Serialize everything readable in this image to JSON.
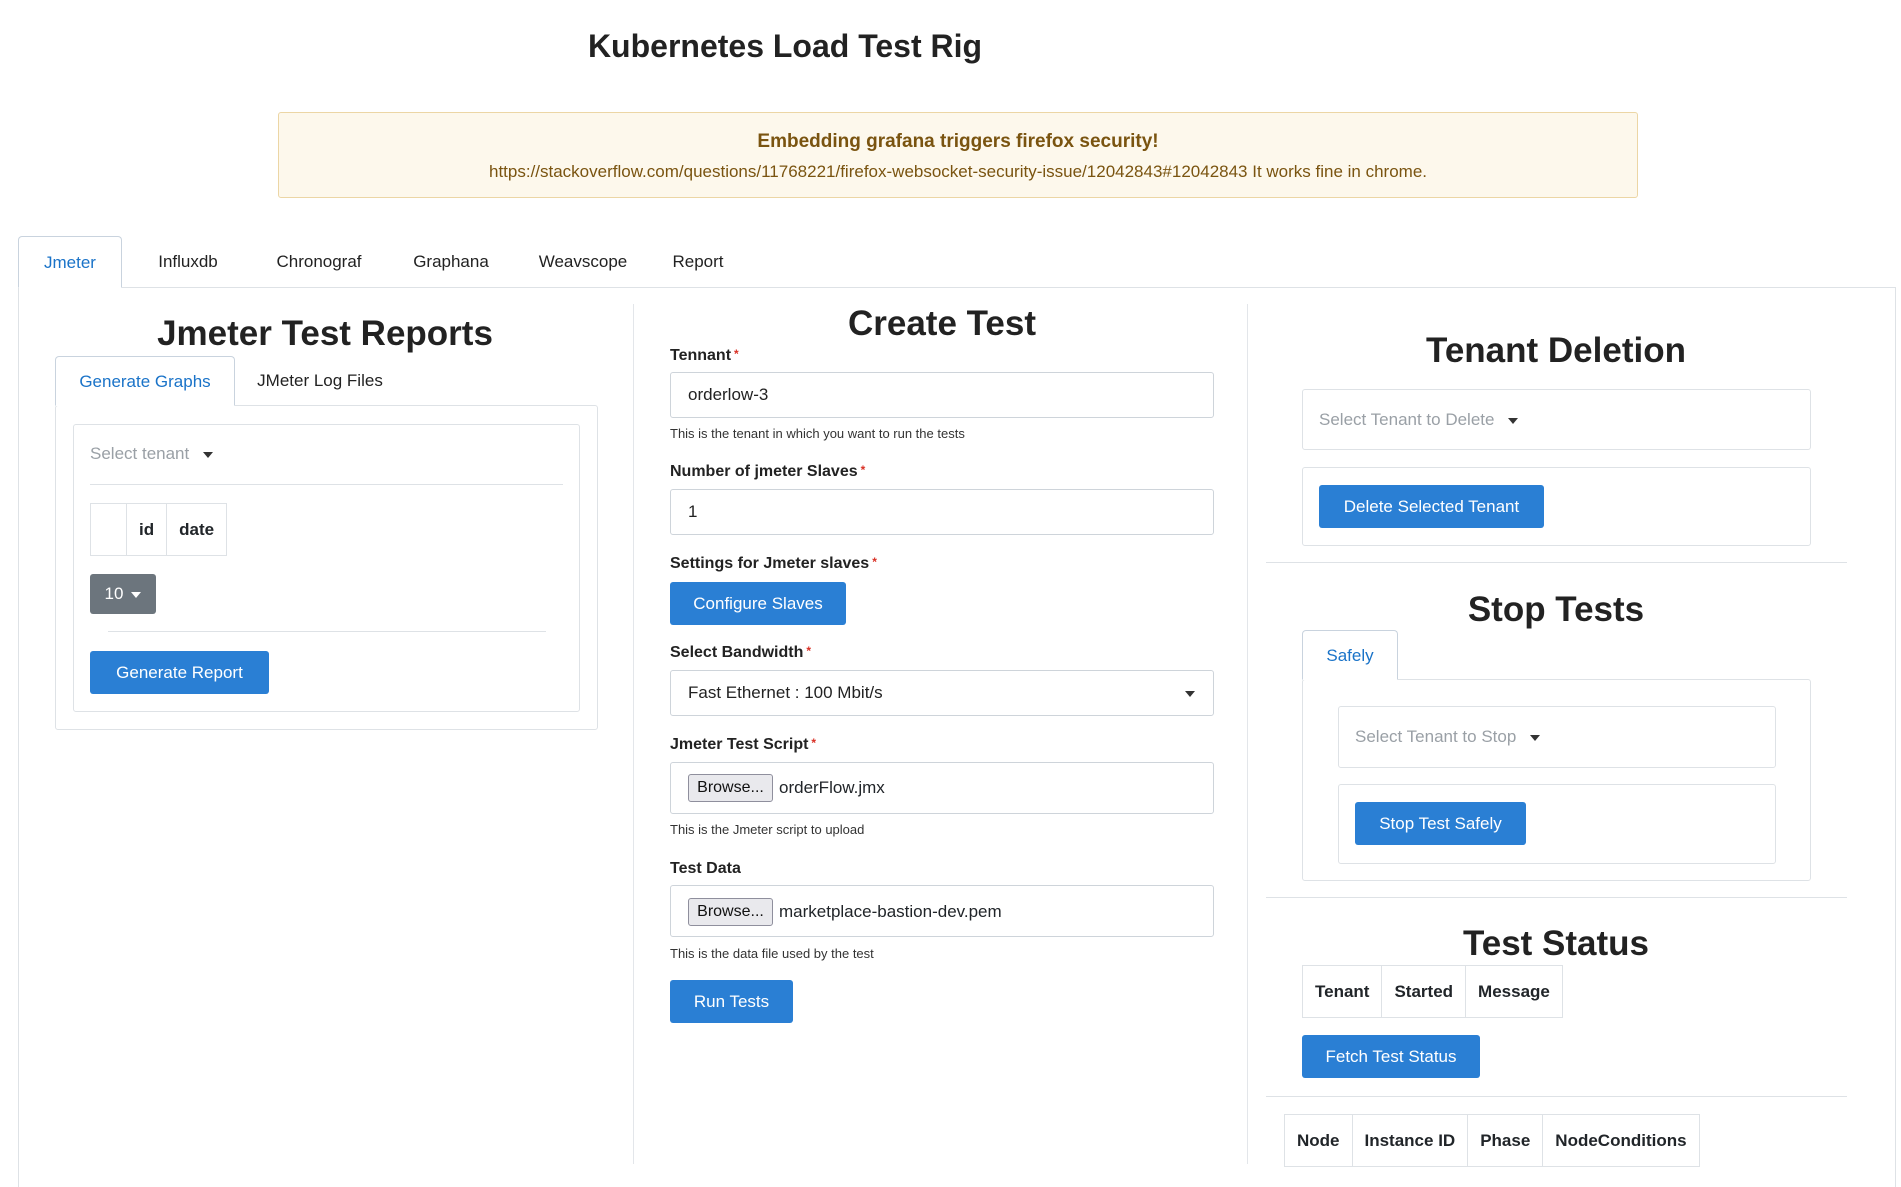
{
  "page": {
    "title": "Kubernetes Load Test Rig"
  },
  "alert": {
    "title": "Embedding grafana triggers firefox security!",
    "message": "https://stackoverflow.com/questions/11768221/firefox-websocket-security-issue/12042843#12042843 It works fine in chrome."
  },
  "tabs": [
    {
      "label": "Jmeter",
      "active": true
    },
    {
      "label": "Influxdb",
      "active": false
    },
    {
      "label": "Chronograf",
      "active": false
    },
    {
      "label": "Graphana",
      "active": false
    },
    {
      "label": "Weavscope",
      "active": false
    },
    {
      "label": "Report",
      "active": false
    }
  ],
  "reports": {
    "title": "Jmeter Test Reports",
    "subtabs": [
      {
        "label": "Generate Graphs",
        "active": true
      },
      {
        "label": "JMeter Log Files",
        "active": false
      }
    ],
    "tenant_placeholder": "Select tenant",
    "table_headers": [
      "",
      "id",
      "date"
    ],
    "page_size": "10",
    "generate_button": "Generate Report"
  },
  "create_test": {
    "title": "Create Test",
    "tenant": {
      "label": "Tennant",
      "value": "orderlow-3",
      "help": "This is the tenant in which you want to run the tests"
    },
    "slaves": {
      "label": "Number of jmeter Slaves",
      "value": "1"
    },
    "settings": {
      "label": "Settings for Jmeter slaves",
      "button": "Configure Slaves"
    },
    "bandwidth": {
      "label": "Select Bandwidth",
      "value": "Fast Ethernet : 100 Mbit/s"
    },
    "script": {
      "label": "Jmeter Test Script",
      "browse": "Browse...",
      "file": "orderFlow.jmx",
      "help": "This is the Jmeter script to upload"
    },
    "data": {
      "label": "Test Data",
      "browse": "Browse...",
      "file": "marketplace-bastion-dev.pem",
      "help": "This is the data file used by the test"
    },
    "run_button": "Run Tests",
    "required_mark": "*"
  },
  "tenant_deletion": {
    "title": "Tenant Deletion",
    "placeholder": "Select Tenant to Delete",
    "button": "Delete Selected Tenant"
  },
  "stop_tests": {
    "title": "Stop Tests",
    "tab": "Safely",
    "placeholder": "Select Tenant to Stop",
    "button": "Stop Test Safely"
  },
  "test_status": {
    "title": "Test Status",
    "headers": [
      "Tenant",
      "Started",
      "Message"
    ],
    "button": "Fetch Test Status"
  },
  "nodes": {
    "headers": [
      "Node",
      "Instance ID",
      "Phase",
      "NodeConditions"
    ]
  }
}
